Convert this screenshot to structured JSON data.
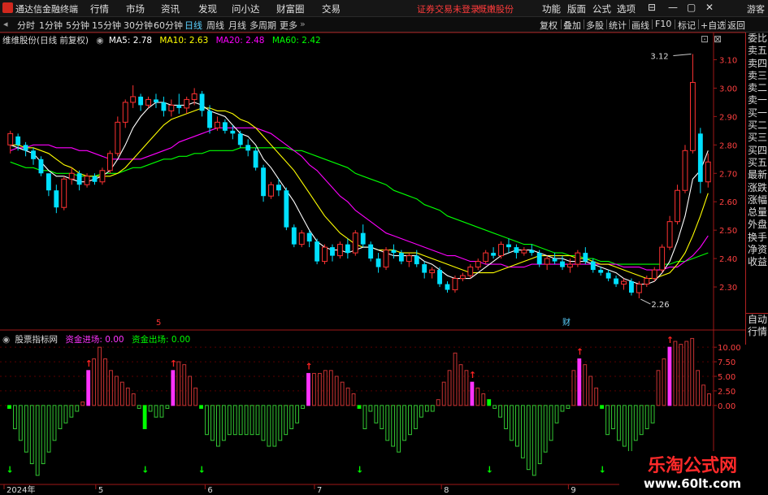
{
  "menubar": {
    "app_title": "通达信金融终端",
    "items": [
      "行情",
      "市场",
      "资讯",
      "发现",
      "问小达",
      "财富圈",
      "交易"
    ],
    "warning": "证券交易未登录",
    "broker": "慨嫩股份",
    "right_items": [
      "功能",
      "版面",
      "公式",
      "选项"
    ],
    "window_buttons": [
      "⊟",
      "—",
      "▢",
      "✕"
    ],
    "guest": "游客"
  },
  "toolbar": {
    "periods": [
      "分时",
      "1分钟",
      "5分钟",
      "15分钟",
      "30分钟",
      "60分钟",
      "日线",
      "周线",
      "月线",
      "多周期",
      "更多"
    ],
    "active": "日线",
    "right_items": [
      "复权",
      "叠加",
      "多股",
      "统计",
      "画线",
      "F10",
      "标记",
      "+自选",
      "返回"
    ]
  },
  "price_legend": {
    "title": "维维股份(日线 前复权)",
    "ma5": "MA5: 2.78",
    "ma10": "MA10: 2.63",
    "ma20": "MA20: 2.48",
    "ma60": "MA60: 2.42",
    "colors": {
      "ma5": "#ffffff",
      "ma10": "#ffff00",
      "ma20": "#ff00ff",
      "ma60": "#00ff00"
    }
  },
  "indicator_legend": {
    "title": "股票指标网",
    "in_label": "资金进场: 0.00",
    "out_label": "资金出场: 0.00",
    "colors": {
      "in": "#ff33ff",
      "out": "#00ff00"
    }
  },
  "right_panel": {
    "top": [
      "委比",
      "卖五",
      "卖四",
      "卖三",
      "卖二",
      "卖一",
      "买一",
      "买二",
      "买三",
      "买四",
      "买五",
      "最新",
      "涨跌",
      "涨幅",
      "总量",
      "外盘",
      "换手",
      "净资",
      "收益"
    ],
    "bottom": [
      "自动",
      "行情"
    ]
  },
  "price_axis": {
    "min": 2.2,
    "max": 3.15,
    "ticks": [
      "3.10",
      "3.00",
      "2.90",
      "2.80",
      "2.70",
      "2.60",
      "2.50",
      "2.40",
      "2.30"
    ],
    "high_label": "3.12",
    "low_label": "2.26"
  },
  "indicator_axis": {
    "min": -13,
    "max": 11,
    "ticks": [
      "10.00",
      "7.50",
      "5.00",
      "2.50",
      "0.00"
    ]
  },
  "time_axis": {
    "labels": [
      "2024年",
      "5",
      "6",
      "7",
      "8",
      "9"
    ],
    "marker_5": "5",
    "marker_finance": "财"
  },
  "chart_data": {
    "type": "candlestick",
    "candles": [
      [
        2.8,
        2.85,
        2.77,
        2.84
      ],
      [
        2.83,
        2.84,
        2.78,
        2.8
      ],
      [
        2.8,
        2.81,
        2.76,
        2.78
      ],
      [
        2.78,
        2.79,
        2.73,
        2.75
      ],
      [
        2.75,
        2.76,
        2.69,
        2.7
      ],
      [
        2.7,
        2.7,
        2.62,
        2.64
      ],
      [
        2.64,
        2.66,
        2.56,
        2.58
      ],
      [
        2.58,
        2.69,
        2.57,
        2.68
      ],
      [
        2.68,
        2.72,
        2.66,
        2.7
      ],
      [
        2.7,
        2.71,
        2.64,
        2.66
      ],
      [
        2.66,
        2.7,
        2.65,
        2.69
      ],
      [
        2.69,
        2.7,
        2.66,
        2.67
      ],
      [
        2.67,
        2.72,
        2.66,
        2.71
      ],
      [
        2.71,
        2.78,
        2.7,
        2.77
      ],
      [
        2.77,
        2.9,
        2.76,
        2.88
      ],
      [
        2.88,
        2.96,
        2.86,
        2.95
      ],
      [
        2.95,
        3.01,
        2.93,
        2.97
      ],
      [
        2.97,
        2.98,
        2.92,
        2.94
      ],
      [
        2.94,
        2.97,
        2.93,
        2.96
      ],
      [
        2.96,
        2.98,
        2.93,
        2.95
      ],
      [
        2.95,
        2.97,
        2.9,
        2.92
      ],
      [
        2.92,
        2.96,
        2.9,
        2.94
      ],
      [
        2.94,
        2.98,
        2.91,
        2.93
      ],
      [
        2.93,
        2.97,
        2.91,
        2.96
      ],
      [
        2.96,
        3.0,
        2.94,
        2.98
      ],
      [
        2.98,
        2.99,
        2.9,
        2.92
      ],
      [
        2.92,
        2.94,
        2.84,
        2.86
      ],
      [
        2.86,
        2.9,
        2.85,
        2.88
      ],
      [
        2.88,
        2.89,
        2.84,
        2.85
      ],
      [
        2.85,
        2.87,
        2.82,
        2.84
      ],
      [
        2.84,
        2.85,
        2.79,
        2.8
      ],
      [
        2.8,
        2.82,
        2.76,
        2.78
      ],
      [
        2.78,
        2.79,
        2.71,
        2.72
      ],
      [
        2.72,
        2.73,
        2.6,
        2.62
      ],
      [
        2.62,
        2.67,
        2.61,
        2.66
      ],
      [
        2.66,
        2.68,
        2.62,
        2.64
      ],
      [
        2.64,
        2.65,
        2.5,
        2.51
      ],
      [
        2.51,
        2.52,
        2.44,
        2.45
      ],
      [
        2.45,
        2.5,
        2.44,
        2.49
      ],
      [
        2.49,
        2.5,
        2.44,
        2.46
      ],
      [
        2.46,
        2.47,
        2.38,
        2.39
      ],
      [
        2.39,
        2.45,
        2.38,
        2.44
      ],
      [
        2.44,
        2.45,
        2.39,
        2.41
      ],
      [
        2.41,
        2.46,
        2.4,
        2.45
      ],
      [
        2.45,
        2.47,
        2.4,
        2.42
      ],
      [
        2.42,
        2.5,
        2.41,
        2.49
      ],
      [
        2.49,
        2.52,
        2.44,
        2.45
      ],
      [
        2.45,
        2.46,
        2.39,
        2.4
      ],
      [
        2.4,
        2.42,
        2.35,
        2.37
      ],
      [
        2.37,
        2.44,
        2.36,
        2.43
      ],
      [
        2.43,
        2.45,
        2.4,
        2.42
      ],
      [
        2.42,
        2.43,
        2.38,
        2.39
      ],
      [
        2.39,
        2.42,
        2.37,
        2.41
      ],
      [
        2.41,
        2.43,
        2.37,
        2.38
      ],
      [
        2.38,
        2.39,
        2.33,
        2.35
      ],
      [
        2.35,
        2.37,
        2.33,
        2.36
      ],
      [
        2.36,
        2.37,
        2.3,
        2.31
      ],
      [
        2.31,
        2.32,
        2.28,
        2.29
      ],
      [
        2.29,
        2.34,
        2.28,
        2.33
      ],
      [
        2.33,
        2.35,
        2.32,
        2.34
      ],
      [
        2.34,
        2.38,
        2.33,
        2.37
      ],
      [
        2.37,
        2.4,
        2.36,
        2.39
      ],
      [
        2.39,
        2.43,
        2.38,
        2.42
      ],
      [
        2.42,
        2.44,
        2.4,
        2.41
      ],
      [
        2.41,
        2.46,
        2.4,
        2.45
      ],
      [
        2.45,
        2.47,
        2.42,
        2.44
      ],
      [
        2.44,
        2.45,
        2.4,
        2.42
      ],
      [
        2.42,
        2.44,
        2.41,
        2.43
      ],
      [
        2.43,
        2.45,
        2.41,
        2.42
      ],
      [
        2.42,
        2.43,
        2.37,
        2.38
      ],
      [
        2.38,
        2.41,
        2.36,
        2.4
      ],
      [
        2.4,
        2.42,
        2.38,
        2.39
      ],
      [
        2.39,
        2.41,
        2.36,
        2.37
      ],
      [
        2.37,
        2.4,
        2.35,
        2.38
      ],
      [
        2.38,
        2.43,
        2.37,
        2.42
      ],
      [
        2.42,
        2.44,
        2.38,
        2.39
      ],
      [
        2.39,
        2.4,
        2.35,
        2.36
      ],
      [
        2.36,
        2.37,
        2.34,
        2.35
      ],
      [
        2.35,
        2.36,
        2.32,
        2.33
      ],
      [
        2.33,
        2.34,
        2.3,
        2.31
      ],
      [
        2.31,
        2.33,
        2.29,
        2.32
      ],
      [
        2.32,
        2.33,
        2.27,
        2.28
      ],
      [
        2.28,
        2.32,
        2.26,
        2.31
      ],
      [
        2.31,
        2.34,
        2.3,
        2.33
      ],
      [
        2.33,
        2.37,
        2.32,
        2.36
      ],
      [
        2.36,
        2.45,
        2.35,
        2.44
      ],
      [
        2.44,
        2.55,
        2.43,
        2.53
      ],
      [
        2.53,
        2.66,
        2.52,
        2.64
      ],
      [
        2.64,
        2.8,
        2.63,
        2.78
      ],
      [
        2.78,
        3.12,
        2.77,
        3.02
      ],
      [
        2.84,
        2.86,
        2.63,
        2.67
      ],
      [
        2.67,
        2.77,
        2.65,
        2.74
      ]
    ],
    "ma5": [
      2.8,
      2.79,
      2.78,
      2.77,
      2.74,
      2.71,
      2.69,
      2.69,
      2.68,
      2.67,
      2.67,
      2.68,
      2.69,
      2.71,
      2.75,
      2.8,
      2.86,
      2.9,
      2.93,
      2.95,
      2.95,
      2.94,
      2.94,
      2.94,
      2.95,
      2.94,
      2.92,
      2.91,
      2.9,
      2.87,
      2.84,
      2.83,
      2.8,
      2.75,
      2.72,
      2.68,
      2.64,
      2.6,
      2.55,
      2.5,
      2.46,
      2.44,
      2.43,
      2.43,
      2.42,
      2.43,
      2.44,
      2.44,
      2.43,
      2.42,
      2.41,
      2.41,
      2.41,
      2.41,
      2.39,
      2.38,
      2.36,
      2.34,
      2.33,
      2.33,
      2.33,
      2.35,
      2.37,
      2.39,
      2.41,
      2.42,
      2.43,
      2.43,
      2.43,
      2.42,
      2.41,
      2.4,
      2.4,
      2.39,
      2.39,
      2.39,
      2.38,
      2.37,
      2.36,
      2.35,
      2.33,
      2.32,
      2.31,
      2.31,
      2.32,
      2.35,
      2.39,
      2.46,
      2.55,
      2.68,
      2.71,
      2.78
    ],
    "ma10": [
      2.8,
      2.8,
      2.79,
      2.79,
      2.78,
      2.77,
      2.75,
      2.73,
      2.72,
      2.7,
      2.69,
      2.69,
      2.69,
      2.69,
      2.7,
      2.72,
      2.75,
      2.78,
      2.81,
      2.84,
      2.87,
      2.89,
      2.9,
      2.91,
      2.92,
      2.93,
      2.93,
      2.92,
      2.92,
      2.91,
      2.89,
      2.88,
      2.86,
      2.83,
      2.8,
      2.77,
      2.74,
      2.71,
      2.67,
      2.63,
      2.59,
      2.55,
      2.52,
      2.49,
      2.47,
      2.45,
      2.44,
      2.44,
      2.43,
      2.43,
      2.43,
      2.42,
      2.42,
      2.42,
      2.41,
      2.4,
      2.39,
      2.38,
      2.37,
      2.36,
      2.35,
      2.35,
      2.35,
      2.35,
      2.36,
      2.37,
      2.38,
      2.39,
      2.4,
      2.41,
      2.41,
      2.41,
      2.41,
      2.41,
      2.4,
      2.4,
      2.39,
      2.38,
      2.38,
      2.37,
      2.36,
      2.35,
      2.34,
      2.33,
      2.33,
      2.34,
      2.35,
      2.38,
      2.42,
      2.48,
      2.55,
      2.63
    ],
    "ma20": [
      2.78,
      2.79,
      2.79,
      2.8,
      2.8,
      2.8,
      2.79,
      2.79,
      2.79,
      2.78,
      2.78,
      2.77,
      2.76,
      2.75,
      2.75,
      2.75,
      2.75,
      2.75,
      2.76,
      2.77,
      2.78,
      2.79,
      2.81,
      2.82,
      2.83,
      2.84,
      2.85,
      2.86,
      2.86,
      2.86,
      2.86,
      2.86,
      2.86,
      2.85,
      2.84,
      2.82,
      2.8,
      2.78,
      2.76,
      2.73,
      2.71,
      2.68,
      2.65,
      2.62,
      2.6,
      2.57,
      2.55,
      2.53,
      2.51,
      2.49,
      2.48,
      2.47,
      2.46,
      2.45,
      2.44,
      2.43,
      2.42,
      2.41,
      2.41,
      2.4,
      2.39,
      2.39,
      2.38,
      2.38,
      2.38,
      2.37,
      2.37,
      2.37,
      2.38,
      2.38,
      2.38,
      2.38,
      2.38,
      2.38,
      2.38,
      2.38,
      2.38,
      2.38,
      2.38,
      2.38,
      2.37,
      2.37,
      2.37,
      2.36,
      2.36,
      2.36,
      2.37,
      2.37,
      2.39,
      2.41,
      2.44,
      2.48
    ],
    "ma60": [
      2.74,
      2.73,
      2.72,
      2.72,
      2.71,
      2.71,
      2.7,
      2.7,
      2.7,
      2.69,
      2.69,
      2.69,
      2.7,
      2.7,
      2.7,
      2.71,
      2.72,
      2.72,
      2.73,
      2.74,
      2.75,
      2.75,
      2.76,
      2.76,
      2.77,
      2.77,
      2.78,
      2.78,
      2.78,
      2.78,
      2.79,
      2.79,
      2.79,
      2.79,
      2.79,
      2.79,
      2.79,
      2.78,
      2.78,
      2.77,
      2.76,
      2.75,
      2.74,
      2.73,
      2.72,
      2.7,
      2.69,
      2.68,
      2.67,
      2.66,
      2.64,
      2.63,
      2.62,
      2.61,
      2.59,
      2.58,
      2.57,
      2.55,
      2.54,
      2.53,
      2.52,
      2.51,
      2.5,
      2.49,
      2.48,
      2.47,
      2.46,
      2.45,
      2.45,
      2.44,
      2.43,
      2.42,
      2.42,
      2.41,
      2.41,
      2.4,
      2.4,
      2.39,
      2.39,
      2.38,
      2.38,
      2.38,
      2.38,
      2.38,
      2.38,
      2.38,
      2.38,
      2.39,
      2.39,
      2.4,
      2.41,
      2.42
    ],
    "indicator": [
      -0.5,
      -4,
      -6,
      -8,
      -10,
      -12,
      -10,
      -8,
      -6,
      -4,
      -3,
      -2,
      -1,
      0.6,
      6,
      8,
      10,
      8,
      6,
      5,
      4,
      3,
      2,
      -0.5,
      -4,
      -1,
      -2,
      -2,
      -0.5,
      6,
      7.5,
      7,
      5,
      3,
      -0.5,
      -5,
      -6,
      -7,
      -6,
      -5,
      -5,
      -5,
      -5,
      -5,
      -5,
      -6,
      -7,
      -7,
      -6,
      -5,
      -4,
      -3,
      -0.5,
      5.5,
      5.5,
      5.5,
      6,
      6,
      5,
      4,
      3,
      2,
      -0.5,
      -4,
      -1,
      -3,
      -4,
      -6,
      -7,
      -8,
      -6,
      -5,
      -4,
      -2,
      -1,
      -1,
      1,
      4,
      6,
      9,
      7,
      6,
      4,
      3,
      2,
      1,
      -0.5,
      -2,
      -4,
      -6,
      -7,
      -9,
      -11,
      -12,
      -10,
      -8,
      -6,
      -3,
      -1,
      -0.5,
      6,
      8,
      7,
      5,
      3,
      -0.5,
      -5,
      -4,
      -6,
      -7,
      -8,
      -6,
      -5,
      -4,
      -3,
      6,
      8,
      10,
      11,
      10.5,
      11,
      11.5,
      6,
      3.5,
      2
    ],
    "up_arrows": [
      14,
      29,
      53,
      82,
      101,
      117,
      130,
      143,
      171,
      183,
      214
    ],
    "down_arrows": [
      0,
      24,
      34,
      62,
      85,
      105,
      130,
      157,
      176,
      205
    ],
    "buy_bars": [
      14,
      29,
      53,
      82,
      101,
      117,
      130,
      143,
      171,
      183,
      214
    ],
    "sell_bars": [
      0,
      24,
      34,
      62,
      85,
      105,
      130,
      157,
      176,
      205
    ]
  }
}
